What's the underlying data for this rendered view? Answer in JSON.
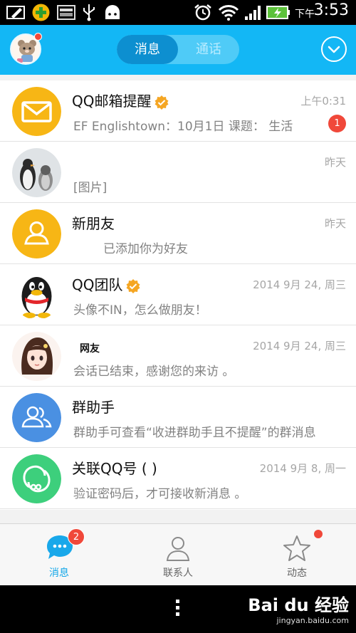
{
  "status_bar": {
    "ampm": "下午",
    "time": "3:53"
  },
  "header": {
    "tabs": [
      {
        "label": "消息",
        "active": true
      },
      {
        "label": "通话",
        "active": false
      }
    ],
    "accent_color": "#13b7f5"
  },
  "conversations": [
    {
      "name": "QQ邮箱提醒",
      "verified": true,
      "time": "上午0:31",
      "message": "EF Englishtown：10月1日 课题： 生活",
      "unread": "1",
      "avatar_icon": "mail-envelope-icon"
    },
    {
      "name": "",
      "verified": false,
      "time": "昨天",
      "message": "[图片]",
      "avatar_icon": "penguins-photo-avatar"
    },
    {
      "name": "新朋友",
      "verified": false,
      "time": "昨天",
      "message": "已添加你为好友",
      "avatar_icon": "person-outline-icon"
    },
    {
      "name": "QQ团队",
      "verified": true,
      "time": "2014 9月 24, 周三",
      "message": "头像不IN，怎么做朋友！",
      "avatar_icon": "qq-penguin-icon"
    },
    {
      "name": "网友",
      "verified": false,
      "time": "2014 9月 24, 周三",
      "message": "会话已结束，感谢您的来访 。",
      "avatar_icon": "cartoon-girl-avatar"
    },
    {
      "name": "群助手",
      "verified": false,
      "time": "",
      "message": "群助手可查看“收进群助手且不提醒”的群消息",
      "avatar_icon": "group-people-icon"
    },
    {
      "name": "关联QQ号 (      )",
      "verified": false,
      "time": "2014 9月 8, 周一",
      "message": "验证密码后，才可接收新消息 。",
      "avatar_icon": "linked-accounts-icon"
    }
  ],
  "tab_bar": {
    "tabs": [
      {
        "label": "消息",
        "badge": "2",
        "active": true,
        "icon": "chat-bubble-icon"
      },
      {
        "label": "联系人",
        "active": false,
        "icon": "contact-person-icon"
      },
      {
        "label": "动态",
        "active": false,
        "icon": "star-icon",
        "has_dot": true
      }
    ]
  },
  "watermark": {
    "main": "Bai du 经验",
    "sub": "jingyan.baidu.com"
  }
}
